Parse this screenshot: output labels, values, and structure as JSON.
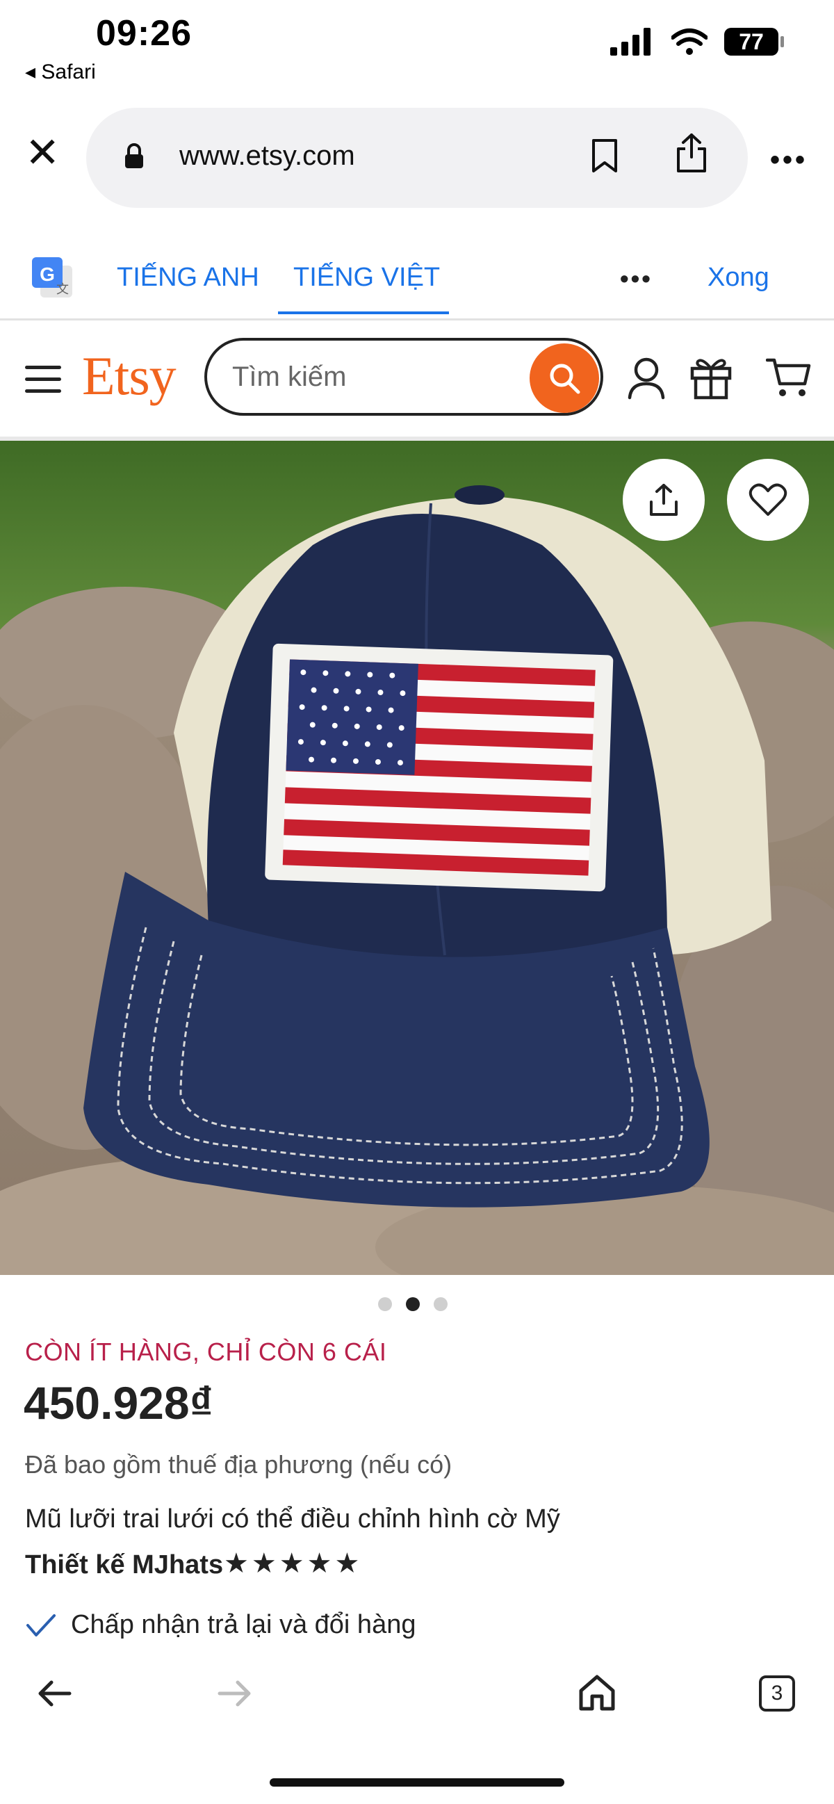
{
  "status_bar": {
    "time": "09:26",
    "back_app": "◂ Safari",
    "battery": "77"
  },
  "browser": {
    "url": "www.etsy.com",
    "tabs_count": "3"
  },
  "translate_bar": {
    "lang_source": "TIẾNG ANH",
    "lang_target": "TIẾNG VIỆT",
    "done_label": "Xong",
    "more": "•••"
  },
  "etsy_header": {
    "logo": "Etsy",
    "search_placeholder": "Tìm kiếm"
  },
  "gallery": {
    "image_count": 3,
    "active_index": 1
  },
  "product": {
    "stock_notice": "CÒN ÍT HÀNG, CHỈ CÒN 6 CÁI",
    "price": "450.928₫",
    "tax_note": "Đã bao gồm thuế địa phương (nếu có)",
    "title": "Mũ lưỡi trai lưới có thể điều chỉnh hình cờ Mỹ",
    "shop_label": "Thiết kế MJhats",
    "rating_stars": "★★★★★",
    "rating_value": 5,
    "returns_label": "Chấp nhận trả lại và đổi hàng"
  },
  "colors": {
    "etsy_orange": "#f1641e",
    "link_blue": "#1a73e8",
    "stock_red": "#b8204a"
  }
}
